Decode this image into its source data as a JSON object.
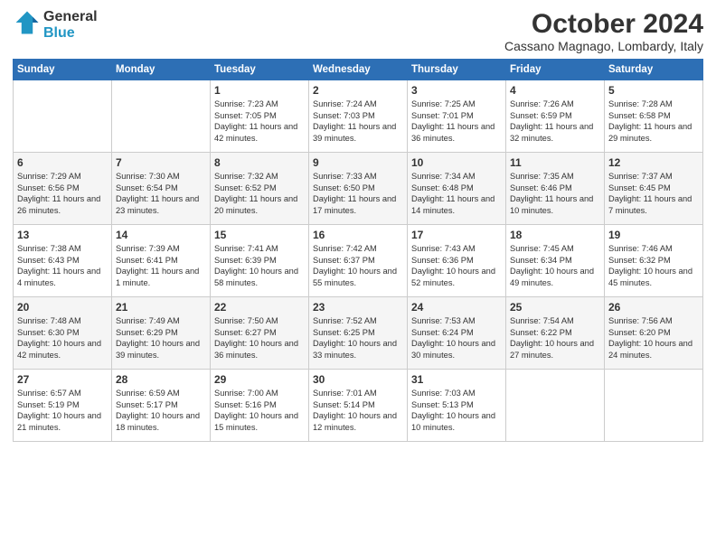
{
  "logo": {
    "text1": "General",
    "text2": "Blue"
  },
  "title": "October 2024",
  "subtitle": "Cassano Magnago, Lombardy, Italy",
  "days_header": [
    "Sunday",
    "Monday",
    "Tuesday",
    "Wednesday",
    "Thursday",
    "Friday",
    "Saturday"
  ],
  "weeks": [
    [
      {
        "day": "",
        "content": ""
      },
      {
        "day": "",
        "content": ""
      },
      {
        "day": "1",
        "content": "Sunrise: 7:23 AM\nSunset: 7:05 PM\nDaylight: 11 hours and 42 minutes."
      },
      {
        "day": "2",
        "content": "Sunrise: 7:24 AM\nSunset: 7:03 PM\nDaylight: 11 hours and 39 minutes."
      },
      {
        "day": "3",
        "content": "Sunrise: 7:25 AM\nSunset: 7:01 PM\nDaylight: 11 hours and 36 minutes."
      },
      {
        "day": "4",
        "content": "Sunrise: 7:26 AM\nSunset: 6:59 PM\nDaylight: 11 hours and 32 minutes."
      },
      {
        "day": "5",
        "content": "Sunrise: 7:28 AM\nSunset: 6:58 PM\nDaylight: 11 hours and 29 minutes."
      }
    ],
    [
      {
        "day": "6",
        "content": "Sunrise: 7:29 AM\nSunset: 6:56 PM\nDaylight: 11 hours and 26 minutes."
      },
      {
        "day": "7",
        "content": "Sunrise: 7:30 AM\nSunset: 6:54 PM\nDaylight: 11 hours and 23 minutes."
      },
      {
        "day": "8",
        "content": "Sunrise: 7:32 AM\nSunset: 6:52 PM\nDaylight: 11 hours and 20 minutes."
      },
      {
        "day": "9",
        "content": "Sunrise: 7:33 AM\nSunset: 6:50 PM\nDaylight: 11 hours and 17 minutes."
      },
      {
        "day": "10",
        "content": "Sunrise: 7:34 AM\nSunset: 6:48 PM\nDaylight: 11 hours and 14 minutes."
      },
      {
        "day": "11",
        "content": "Sunrise: 7:35 AM\nSunset: 6:46 PM\nDaylight: 11 hours and 10 minutes."
      },
      {
        "day": "12",
        "content": "Sunrise: 7:37 AM\nSunset: 6:45 PM\nDaylight: 11 hours and 7 minutes."
      }
    ],
    [
      {
        "day": "13",
        "content": "Sunrise: 7:38 AM\nSunset: 6:43 PM\nDaylight: 11 hours and 4 minutes."
      },
      {
        "day": "14",
        "content": "Sunrise: 7:39 AM\nSunset: 6:41 PM\nDaylight: 11 hours and 1 minute."
      },
      {
        "day": "15",
        "content": "Sunrise: 7:41 AM\nSunset: 6:39 PM\nDaylight: 10 hours and 58 minutes."
      },
      {
        "day": "16",
        "content": "Sunrise: 7:42 AM\nSunset: 6:37 PM\nDaylight: 10 hours and 55 minutes."
      },
      {
        "day": "17",
        "content": "Sunrise: 7:43 AM\nSunset: 6:36 PM\nDaylight: 10 hours and 52 minutes."
      },
      {
        "day": "18",
        "content": "Sunrise: 7:45 AM\nSunset: 6:34 PM\nDaylight: 10 hours and 49 minutes."
      },
      {
        "day": "19",
        "content": "Sunrise: 7:46 AM\nSunset: 6:32 PM\nDaylight: 10 hours and 45 minutes."
      }
    ],
    [
      {
        "day": "20",
        "content": "Sunrise: 7:48 AM\nSunset: 6:30 PM\nDaylight: 10 hours and 42 minutes."
      },
      {
        "day": "21",
        "content": "Sunrise: 7:49 AM\nSunset: 6:29 PM\nDaylight: 10 hours and 39 minutes."
      },
      {
        "day": "22",
        "content": "Sunrise: 7:50 AM\nSunset: 6:27 PM\nDaylight: 10 hours and 36 minutes."
      },
      {
        "day": "23",
        "content": "Sunrise: 7:52 AM\nSunset: 6:25 PM\nDaylight: 10 hours and 33 minutes."
      },
      {
        "day": "24",
        "content": "Sunrise: 7:53 AM\nSunset: 6:24 PM\nDaylight: 10 hours and 30 minutes."
      },
      {
        "day": "25",
        "content": "Sunrise: 7:54 AM\nSunset: 6:22 PM\nDaylight: 10 hours and 27 minutes."
      },
      {
        "day": "26",
        "content": "Sunrise: 7:56 AM\nSunset: 6:20 PM\nDaylight: 10 hours and 24 minutes."
      }
    ],
    [
      {
        "day": "27",
        "content": "Sunrise: 6:57 AM\nSunset: 5:19 PM\nDaylight: 10 hours and 21 minutes."
      },
      {
        "day": "28",
        "content": "Sunrise: 6:59 AM\nSunset: 5:17 PM\nDaylight: 10 hours and 18 minutes."
      },
      {
        "day": "29",
        "content": "Sunrise: 7:00 AM\nSunset: 5:16 PM\nDaylight: 10 hours and 15 minutes."
      },
      {
        "day": "30",
        "content": "Sunrise: 7:01 AM\nSunset: 5:14 PM\nDaylight: 10 hours and 12 minutes."
      },
      {
        "day": "31",
        "content": "Sunrise: 7:03 AM\nSunset: 5:13 PM\nDaylight: 10 hours and 10 minutes."
      },
      {
        "day": "",
        "content": ""
      },
      {
        "day": "",
        "content": ""
      }
    ]
  ]
}
